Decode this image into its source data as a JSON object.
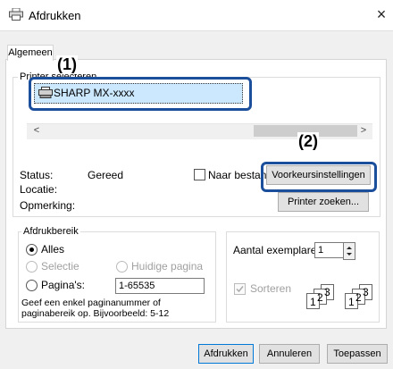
{
  "window": {
    "title": "Afdrukken",
    "close_glyph": "×"
  },
  "tabs": [
    {
      "label": "Algemeen"
    }
  ],
  "printer_group": {
    "label": "Printer selecteren",
    "selected_printer": "SHARP MX-xxxx",
    "scroll_left": "<",
    "scroll_right": ">",
    "status_label": "Status:",
    "status_value": "Gereed",
    "location_label": "Locatie:",
    "comment_label": "Opmerking:",
    "print_to_file_label": "Naar bestand",
    "print_to_file_checked": false,
    "preferences_button": "Voorkeursinstellingen",
    "find_printer_button": "Printer zoeken..."
  },
  "callouts": {
    "one": "(1)",
    "two": "(2)"
  },
  "page_range": {
    "label": "Afdrukbereik",
    "all": "Alles",
    "selection": "Selectie",
    "current_page": "Huidige pagina",
    "pages": "Pagina's:",
    "pages_value": "1-65535",
    "help": "Geef een enkel paginanummer of paginabereik op. Bijvoorbeeld: 5-12",
    "selected": "all"
  },
  "copies": {
    "label": "Aantal exemplaren:",
    "value": "1",
    "collate_label": "Sorteren",
    "collate_checked": true
  },
  "buttons": {
    "print": "Afdrukken",
    "cancel": "Annuleren",
    "apply": "Toepassen"
  },
  "colors": {
    "accent_callout": "#1b4f9c",
    "selection_blue": "#cce8ff"
  }
}
